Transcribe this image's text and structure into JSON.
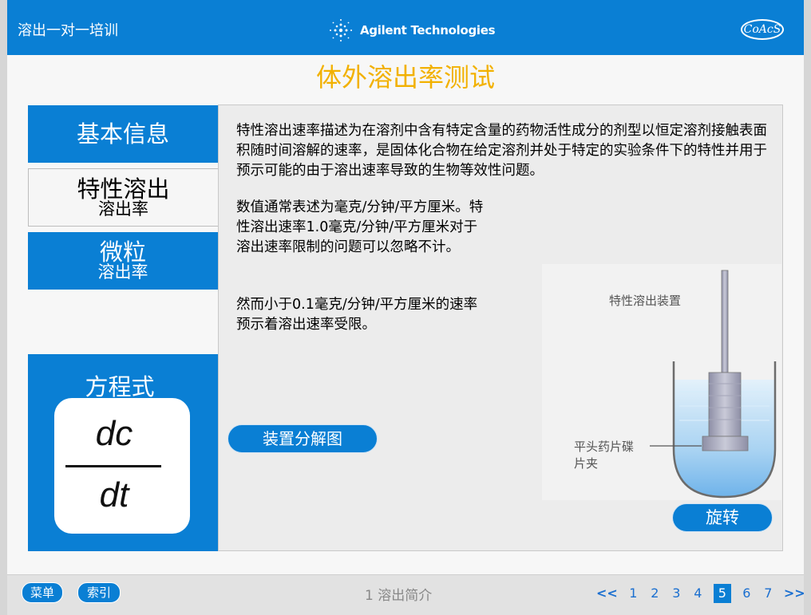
{
  "header": {
    "course_title": "溶出一对一培训",
    "brand_name": "Agilent Technologies",
    "partner_logo_text": "CoAcS"
  },
  "page_title": "体外溶出率测试",
  "sidebar": {
    "tabs": [
      {
        "label": "基本信息"
      },
      {
        "label_main": "特性溶出",
        "label_sub": "溶出率",
        "active": true
      },
      {
        "label_main": "微粒",
        "label_sub": "溶出率"
      }
    ],
    "formula": {
      "title": "方程式",
      "numerator": "dc",
      "denominator": "dt"
    }
  },
  "content": {
    "paragraph1": "特性溶出速率描述为在溶剂中含有特定含量的药物活性成分的剂型以恒定溶剂接触表面积随时间溶解的速率，是固体化合物在给定溶剂并处于特定的实验条件下的特性并用于预示可能的由于溶出速率导致的生物等效性问题。",
    "paragraph2": "数值通常表述为毫克/分钟/平方厘米。特性溶出速率1.0毫克/分钟/平方厘米对于溶出速率限制的问题可以忽略不计。",
    "paragraph3": "然而小于0.1毫克/分钟/平方厘米的速率预示着溶出速率受限。",
    "exploded_button": "装置分解图",
    "rotate_button": "旋转",
    "apparatus": {
      "title": "特性溶出装置",
      "holder_label_line1": "平头药片碟",
      "holder_label_line2": "片夹"
    }
  },
  "footer": {
    "menu_button": "菜单",
    "index_button": "索引",
    "section_label": "1 溶出简介",
    "pager": {
      "prev": "<<",
      "next": ">>",
      "pages": [
        "1",
        "2",
        "3",
        "4",
        "5",
        "6",
        "7"
      ],
      "current": "5"
    }
  },
  "colors": {
    "primary_blue": "#0a7fd4",
    "title_gold": "#f2b100"
  }
}
